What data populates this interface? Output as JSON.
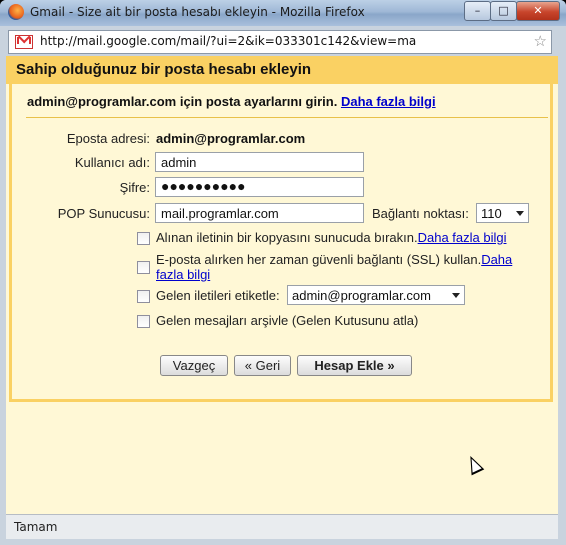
{
  "window": {
    "title": "Gmail - Size ait bir posta hesabı ekleyin - Mozilla Firefox",
    "minimize": "–",
    "maximize": "□",
    "close": "✕"
  },
  "urlbar": {
    "url": "http://mail.google.com/mail/?ui=2&ik=033301c142&view=ma"
  },
  "dialog": {
    "title": "Sahip olduğunuz bir posta hesabı ekleyin",
    "subhead": "admin@programlar.com için posta ayarlarını girin.",
    "subhead_link": "Daha fazla bilgi",
    "fields": {
      "email_label": "Eposta adresi:",
      "email_value": "admin@programlar.com",
      "username_label": "Kullanıcı adı:",
      "username_value": "admin",
      "password_label": "Şifre:",
      "password_value": "●●●●●●●●●●",
      "pop_label": "POP Sunucusu:",
      "pop_value": "mail.programlar.com",
      "port_label": "Bağlantı noktası:",
      "port_value": "110"
    },
    "options": {
      "leave_copy": "Alınan iletinin bir kopyasını sunucuda bırakın.",
      "leave_copy_link": "Daha fazla bilgi",
      "ssl_text": "E-posta alırken her zaman güvenli bağlantı (SSL) kullan.",
      "ssl_link_part1": "Daha",
      "ssl_link_part2": "fazla bilgi",
      "label_text": "Gelen iletileri etiketle:",
      "label_value": "admin@programlar.com",
      "archive_text": "Gelen mesajları arşivle (Gelen Kutusunu atla)"
    },
    "buttons": {
      "cancel": "Vazgeç",
      "back": "« Geri",
      "add": "Hesap Ekle »"
    }
  },
  "statusbar": {
    "text": "Tamam"
  }
}
